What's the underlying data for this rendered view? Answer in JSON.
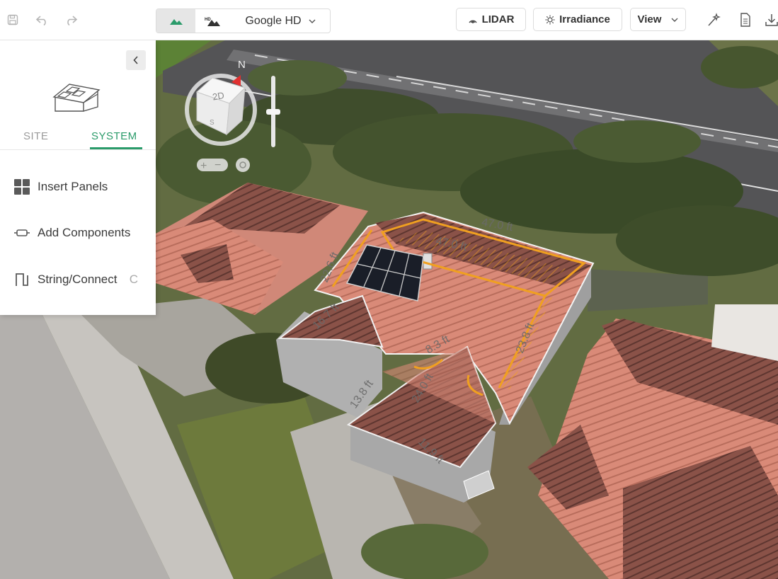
{
  "toolbar": {
    "imagery_selected": "Google HD",
    "lidar_label": "LIDAR",
    "irradiance_label": "Irradiance",
    "view_label": "View",
    "hd_badge": "HD"
  },
  "sidebar": {
    "tabs": [
      {
        "label": "SITE",
        "active": false
      },
      {
        "label": "SYSTEM",
        "active": true
      }
    ],
    "items": [
      {
        "label": "Insert Panels",
        "icon": "grid-icon"
      },
      {
        "label": "Add Components",
        "icon": "component-icon"
      },
      {
        "label": "String/Connect",
        "icon": "string-icon",
        "shortcut": "C"
      }
    ]
  },
  "map": {
    "compass": {
      "north": "N",
      "south": "S",
      "mode": "2D"
    },
    "measurements": [
      "47.0 ft",
      "47.0 ft",
      "22.6 ft",
      "16.7 ft",
      "23.8 ft",
      "8.3 ft",
      "24.0 ft",
      "13.8 ft",
      "11.9 ft"
    ]
  },
  "colors": {
    "accent": "#2a9b6a",
    "setback": "#f0a020",
    "roof": "#d9897a"
  }
}
